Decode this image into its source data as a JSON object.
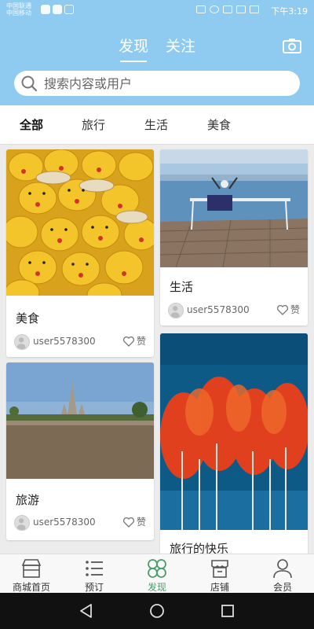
{
  "status_bar": {
    "carrier_line1": "中国联通",
    "carrier_line2": "中国移动",
    "time": "下午3:19"
  },
  "header": {
    "tabs": [
      {
        "label": "发现",
        "active": true
      },
      {
        "label": "关注",
        "active": false
      }
    ],
    "camera_icon": "camera-icon",
    "accent_color": "#8fcbf0"
  },
  "search": {
    "placeholder": "搜索内容或用户",
    "value": ""
  },
  "categories": [
    {
      "label": "全部",
      "active": true
    },
    {
      "label": "旅行",
      "active": false
    },
    {
      "label": "生活",
      "active": false
    },
    {
      "label": "美食",
      "active": false
    }
  ],
  "feed": {
    "cards": [
      {
        "title": "美食",
        "user": "user5578300",
        "like_label": "赞",
        "image": "yellow-duck-macarons"
      },
      {
        "title": "生活",
        "user": "user5578300",
        "like_label": "赞",
        "image": "lakeside-deck-chair"
      },
      {
        "title": "旅游",
        "user": "user5578300",
        "like_label": "赞",
        "image": "riverside-temple"
      },
      {
        "title": "旅行的快乐",
        "user": "",
        "like_label": "",
        "image": "red-autumn-trees"
      }
    ]
  },
  "bottom_nav": {
    "items": [
      {
        "label": "商城首页",
        "icon": "shop-icon",
        "active": false
      },
      {
        "label": "预订",
        "icon": "list-icon",
        "active": false
      },
      {
        "label": "发现",
        "icon": "clover-icon",
        "active": true
      },
      {
        "label": "店铺",
        "icon": "store-icon",
        "active": false
      },
      {
        "label": "会员",
        "icon": "person-icon",
        "active": false
      }
    ],
    "active_color": "#4a9e6a"
  }
}
